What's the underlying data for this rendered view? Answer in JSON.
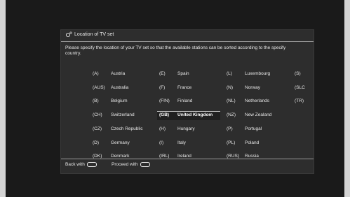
{
  "dialog": {
    "title": "Location of TV set",
    "description": "Please specify the location of your TV set so that the available stations can be sorted according to the specify country."
  },
  "countries": [
    {
      "code": "(A)",
      "name": "Austria"
    },
    {
      "code": "(AUS)",
      "name": "Australia"
    },
    {
      "code": "(B)",
      "name": "Belgium"
    },
    {
      "code": "(CH)",
      "name": "Switzerland"
    },
    {
      "code": "(CZ)",
      "name": "Czech Republic"
    },
    {
      "code": "(D)",
      "name": "Germany"
    },
    {
      "code": "(DK)",
      "name": "Denmark"
    },
    {
      "code": "(E)",
      "name": "Spain"
    },
    {
      "code": "(F)",
      "name": "France"
    },
    {
      "code": "(FIN)",
      "name": "Finland"
    },
    {
      "code": "(GB)",
      "name": "United Kingdom"
    },
    {
      "code": "(H)",
      "name": "Hungary"
    },
    {
      "code": "(I)",
      "name": "Italy"
    },
    {
      "code": "(IRL)",
      "name": "Ireland"
    },
    {
      "code": "(L)",
      "name": "Luxembourg"
    },
    {
      "code": "(N)",
      "name": "Norway"
    },
    {
      "code": "(NL)",
      "name": "Netherlands"
    },
    {
      "code": "(NZ)",
      "name": "New Zealand"
    },
    {
      "code": "(P)",
      "name": "Portugal"
    },
    {
      "code": "(PL)",
      "name": "Poland"
    },
    {
      "code": "(RUS)",
      "name": "Russia"
    },
    {
      "code": "(S)",
      "name": ""
    },
    {
      "code": "(SLC",
      "name": ""
    },
    {
      "code": "(TR)",
      "name": ""
    }
  ],
  "selected_code": "(GB)",
  "footer": {
    "back_label": "Back with",
    "proceed_label": "Proceed with"
  }
}
